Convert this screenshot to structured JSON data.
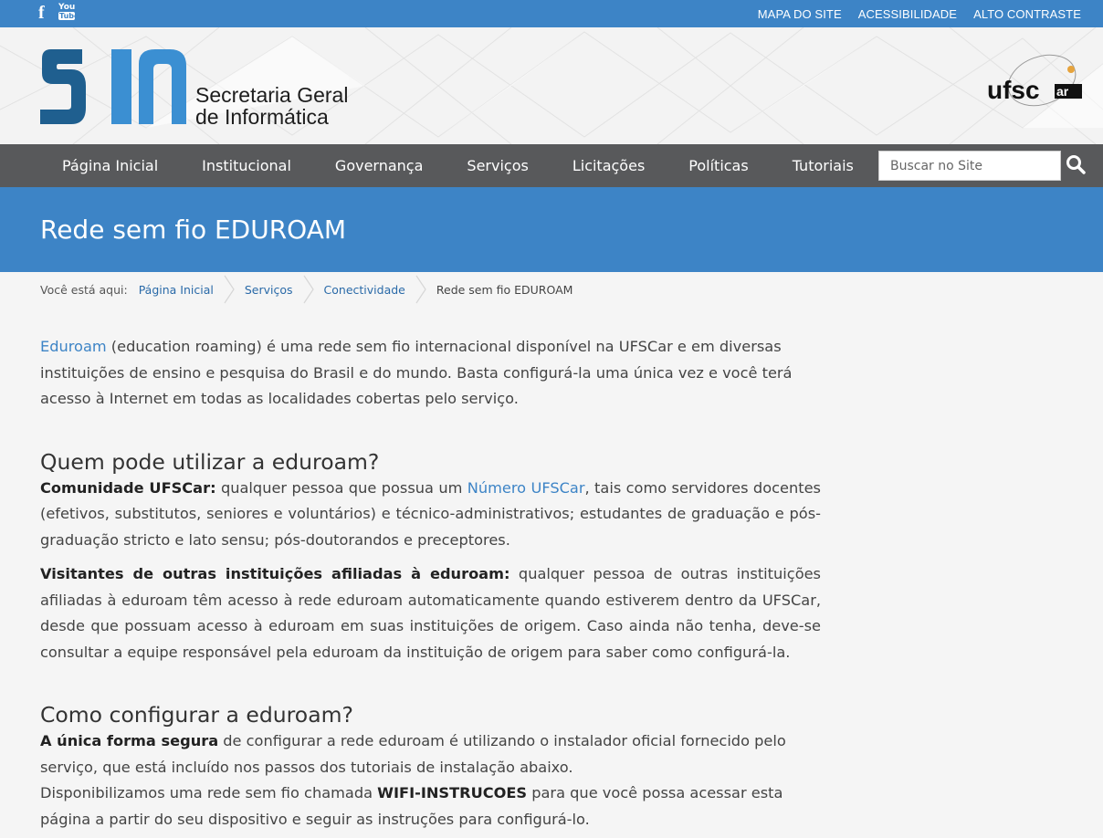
{
  "topbar": {
    "social": {
      "facebook_icon": "facebook-icon",
      "youtube_icon_top": "You",
      "youtube_icon_bottom": "Tube"
    },
    "links": [
      "MAPA DO SITE",
      "ACESSIBILIDADE",
      "ALTO CONTRASTE"
    ]
  },
  "header": {
    "logo_line1": "Secretaria Geral",
    "logo_line2": "de Informática",
    "ufscar_logo": "UFSCar"
  },
  "nav": {
    "items": [
      "Página Inicial",
      "Institucional",
      "Governança",
      "Serviços",
      "Licitações",
      "Políticas",
      "Tutoriais"
    ],
    "search_placeholder": "Buscar no Site"
  },
  "page": {
    "title": "Rede sem fio EDUROAM"
  },
  "breadcrumb": {
    "label": "Você está aqui:",
    "items": [
      "Página Inicial",
      "Serviços",
      "Conectividade"
    ],
    "current": "Rede sem fio EDUROAM"
  },
  "content": {
    "intro_link": "Eduroam",
    "intro_text": " (education roaming) é uma rede sem fio internacional disponível na UFSCar e em diversas instituições de ensino e pesquisa do Brasil e do mundo.  Basta configurá-la uma única vez e você terá acesso à Internet em todas as localidades cobertas pelo serviço.",
    "h_who": "Quem pode utilizar a eduroam?",
    "who1_bold": "Comunidade UFSCar:",
    "who1_pre": " qualquer pessoa que possua um ",
    "who1_link": "Número UFSCar",
    "who1_post": ", tais como servidores docentes (efetivos, substitutos, seniores e voluntários) e técnico-administrativos; estudantes de graduação e pós-graduação stricto e lato sensu; pós-doutorandos e preceptores.",
    "who2_bold": "Visitantes de outras instituições afiliadas à eduroam:",
    "who2_text": " qualquer pessoa de outras instituições afiliadas à eduroam têm acesso à rede eduroam automaticamente quando estiverem dentro da UFSCar, desde que possuam acesso à eduroam em suas instituições de origem. Caso ainda não tenha, deve-se consultar a equipe responsável pela eduroam da instituição de origem para saber como configurá-la.",
    "h_how": "Como configurar a eduroam?",
    "how1_bold": "A única forma segura",
    "how1_text": " de configurar a rede eduroam é utilizando o instalador oficial fornecido pelo serviço, que está incluído nos passos dos tutoriais de instalação abaixo.",
    "how2_pre": "Disponibilizamos uma rede sem fio chamada ",
    "how2_bold": "WIFI-INSTRUCOES",
    "how2_post": " para que você possa acessar esta página a partir do seu dispositivo e seguir as instruções para configurá-lo."
  },
  "colors": {
    "brand_blue": "#3d84c6",
    "nav_gray": "#58595b",
    "logo_dark": "#1f5f8f",
    "logo_light": "#3b8fd2"
  }
}
